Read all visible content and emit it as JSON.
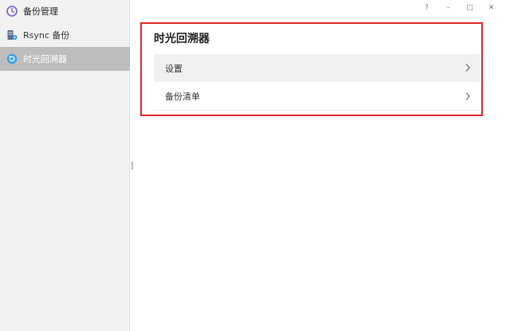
{
  "app": {
    "title": "备份管理",
    "icon": "clock-icon",
    "accent": "#7a5cd1"
  },
  "sidebar": {
    "items": [
      {
        "label": "Rsync 备份",
        "icon": "rsync-server-icon",
        "selected": false
      },
      {
        "label": "时光回溯器",
        "icon": "time-machine-icon",
        "selected": true
      }
    ],
    "selected_bg": "#bdbdbd"
  },
  "window_controls": {
    "help": "?",
    "minimize": "–",
    "maximize": "□",
    "close": "✕"
  },
  "main": {
    "title": "时光回溯器",
    "highlight_color": "#e3262b",
    "rows": [
      {
        "label": "设置",
        "icon": "chevron-right-icon"
      },
      {
        "label": "备份清单",
        "icon": "chevron-right-icon"
      }
    ]
  }
}
